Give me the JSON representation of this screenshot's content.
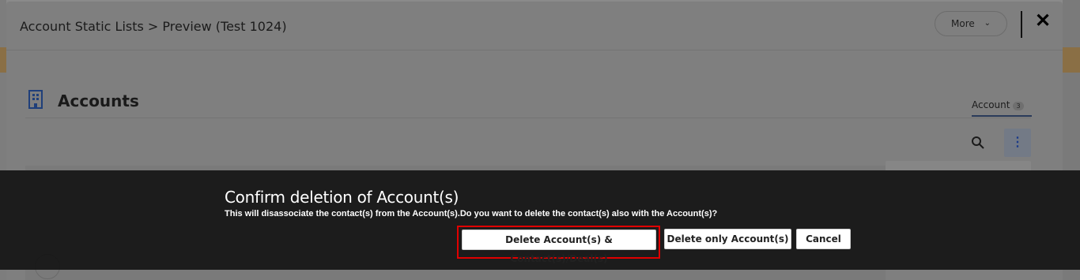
{
  "header": {
    "title": "Account Static Lists > Preview (Test 1024)",
    "more_label": "More",
    "close_glyph": "✕"
  },
  "section": {
    "title": "Accounts",
    "tab_label": "Account",
    "tab_count": "3"
  },
  "confirm_dialog": {
    "title": "Confirm deletion of Account(s)",
    "message": "This will disassociate the contact(s) from the Account(s).Do you want to delete the contact(s) also with the Account(s)?",
    "buttons": {
      "delete_all": "Delete Account(s) & Contact(s)/Deal(s)",
      "delete_only": "Delete only Account(s)",
      "cancel": "Cancel"
    }
  },
  "colors": {
    "overlay": "#141414",
    "highlight": "#e00000",
    "button_bg": "#ffffff"
  },
  "icons": [
    "building-icon",
    "search-icon",
    "kebab-menu-icon",
    "close-icon",
    "chevron-down-icon"
  ]
}
